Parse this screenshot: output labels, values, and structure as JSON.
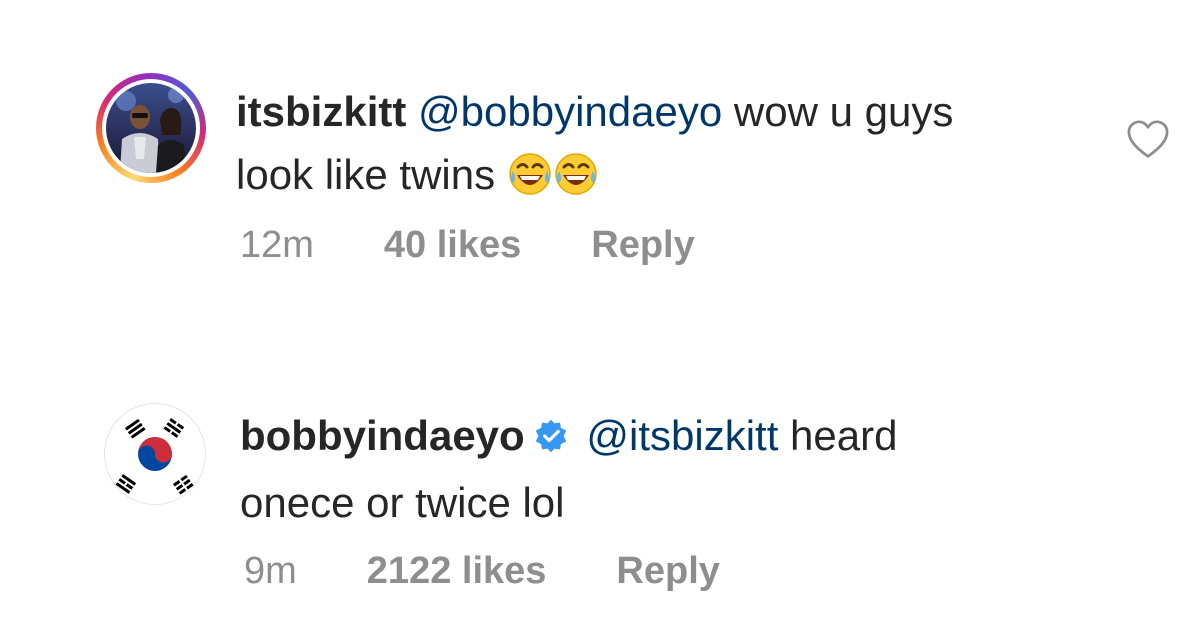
{
  "comments": [
    {
      "username": "itsbizkitt",
      "mention": "@bobbyindaeyo",
      "text_line1": "wow u guys",
      "text_line2": "look like twins",
      "emoji": [
        "face-with-tears-of-joy",
        "face-with-tears-of-joy"
      ],
      "time": "12m",
      "likes": "40 likes",
      "reply": "Reply",
      "avatar_icon": "profile-photo"
    },
    {
      "username": "bobbyindaeyo",
      "verified": true,
      "mention": "@itsbizkitt",
      "text_line1": "heard",
      "text_line2": "onece or twice lol",
      "time": "9m",
      "likes": "2122 likes",
      "reply": "Reply",
      "avatar_icon": "south-korea-flag"
    }
  ],
  "icons": {
    "like": "heart-outline-icon",
    "verified": "verified-badge-icon"
  },
  "colors": {
    "mention": "#00376b",
    "meta": "#8e8e8e",
    "verified": "#3897f0"
  }
}
